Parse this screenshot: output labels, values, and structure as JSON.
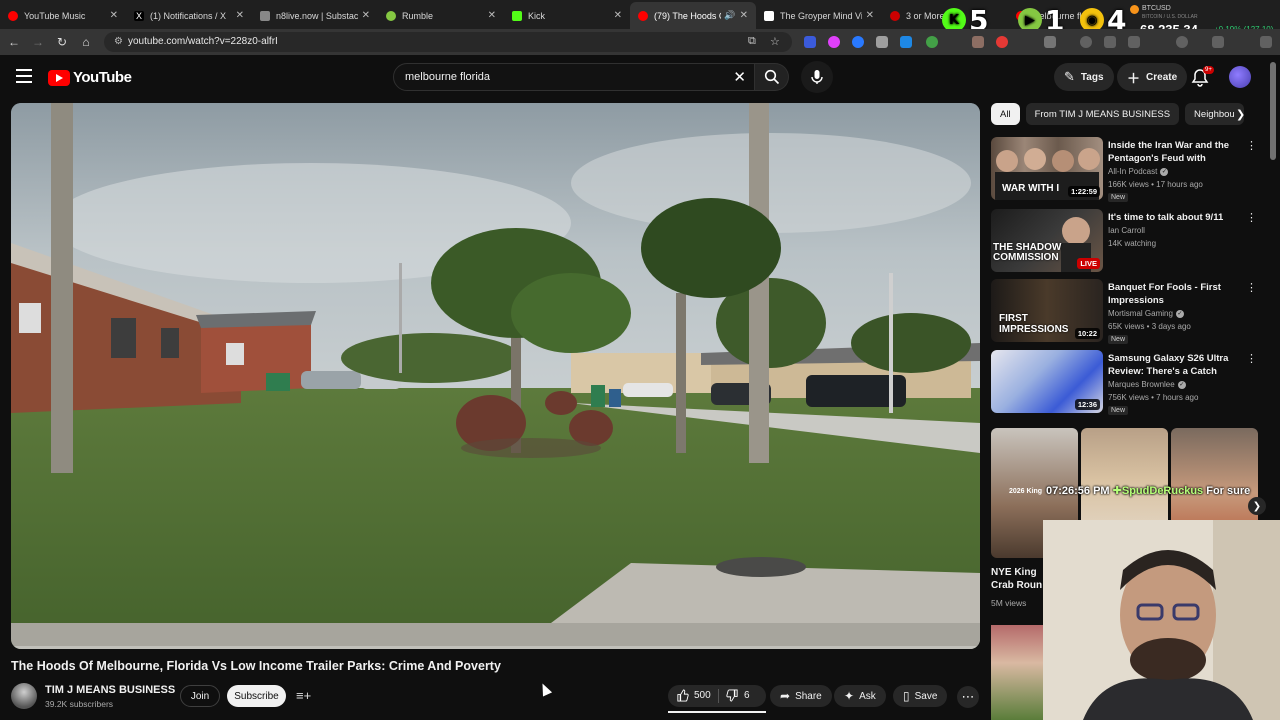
{
  "browser": {
    "tabs": [
      {
        "title": "YouTube Music",
        "color": "#ff0000"
      },
      {
        "title": "(1) Notifications / X",
        "color": "#ffffff"
      },
      {
        "title": "n8live.now | Substack",
        "color": "#888888"
      },
      {
        "title": "Rumble",
        "color": "#85c742"
      },
      {
        "title": "Kick",
        "color": "#53fc18"
      },
      {
        "title": "(79) The Hoods O",
        "color": "#ff0000",
        "active": true
      },
      {
        "title": "The Groyper Mind Vir",
        "color": "#ffffff"
      },
      {
        "title": "3 or More",
        "color": "#cc0000"
      },
      {
        "title": "melbourne fl",
        "color": "#ff0000"
      }
    ],
    "url": "youtube.com/watch?v=228z0-alfrI",
    "overlay_numbers": {
      "k": "5",
      "rumble": "1",
      "third": "4"
    },
    "ticker": {
      "symbol": "BTCUSD",
      "sub": "BITCOIN / U.S. DOLLAR",
      "price": "68,235.34",
      "change": "+0.19% (127.10)"
    }
  },
  "masthead": {
    "logo_text": "YouTube",
    "search_value": "melbourne florida",
    "tags_label": "Tags",
    "create_label": "Create",
    "notif_count": "9+"
  },
  "video": {
    "title": "The Hoods Of Melbourne, Florida Vs Low Income Trailer Parks: Crime And Poverty",
    "channel": "TIM J MEANS BUSINESS",
    "subscribers": "39.2K subscribers",
    "join_label": "Join",
    "subscribe_label": "Subscribe",
    "likes": "500",
    "dislikes": "6",
    "share_label": "Share",
    "ask_label": "Ask",
    "save_label": "Save",
    "progress_fraction": 0.0
  },
  "sidebar": {
    "chips": [
      "All",
      "From TIM J MEANS BUSINESS",
      "Neighbou"
    ],
    "recommendations": [
      {
        "title": "Inside the Iran War and the Pentagon's Feud with Anthropi...",
        "channel": "All-In Podcast",
        "verified": true,
        "meta": "166K views • 17 hours ago",
        "badge": "New",
        "duration": "1:22:59",
        "thumb_text": "WAR WITH I"
      },
      {
        "title": "It's time to talk about 9/11",
        "channel": "Ian Carroll",
        "verified": false,
        "meta": "14K watching",
        "badge": "",
        "live": "LIVE",
        "thumb_text": "THE SHADOW COMMISSION"
      },
      {
        "title": "Banquet For Fools - First Impressions",
        "channel": "Mortismal Gaming",
        "verified": true,
        "meta": "65K views • 3 days ago",
        "badge": "New",
        "duration": "10:22",
        "thumb_text": "FIRST IMPRESSIONS"
      },
      {
        "title": "Samsung Galaxy S26 Ultra Review: There's a Catch",
        "channel": "Marques Brownlee",
        "verified": true,
        "meta": "756K views • 7 hours ago",
        "badge": "New",
        "duration": "12:36",
        "thumb_text": ""
      }
    ],
    "shorts_title": "NYE King Crab Roun",
    "shorts_views": "5M views",
    "shorts_caption": "2026 King"
  },
  "stream_overlay": {
    "time": "07:26:56 PM",
    "user": "SpudDeRuckus",
    "msg": "For sure"
  },
  "colors": {
    "accent": "#ff0000",
    "background": "#0f0f0f",
    "chip_selected": "#f1f1f1"
  }
}
